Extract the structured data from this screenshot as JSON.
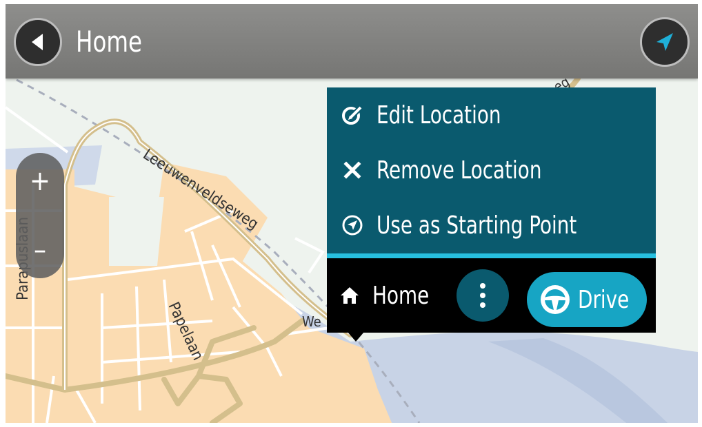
{
  "header": {
    "title": "Home",
    "back_icon": "chevron-left-icon",
    "location_icon": "navigation-arrow-icon"
  },
  "zoom": {
    "in_label": "+",
    "out_label": "–"
  },
  "map": {
    "streets": [
      "Leeuwenveldseweg",
      "Papelaan",
      "Parapuslaan",
      "We",
      "eg"
    ]
  },
  "menu": {
    "items": [
      {
        "label": "Edit Location",
        "icon": "edit-location-icon"
      },
      {
        "label": "Remove Location",
        "icon": "close-icon"
      },
      {
        "label": "Use as Starting Point",
        "icon": "starting-point-icon"
      }
    ]
  },
  "action_bar": {
    "label": "Home",
    "icon": "home-icon",
    "more_icon": "vertical-dots-icon",
    "drive_label": "Drive",
    "drive_icon": "steering-wheel-icon"
  },
  "colors": {
    "menu_background": "#0a5a6e",
    "menu_divider": "#27c0e0",
    "drive_button": "#17a5c4",
    "top_bar": "#828280",
    "map_land": "#eef3ee",
    "map_urban": "#fbdcb2",
    "map_water": "#c8d3e6",
    "map_road": "#d4bf8c",
    "navigation_arrow": "#1fb0d8"
  }
}
